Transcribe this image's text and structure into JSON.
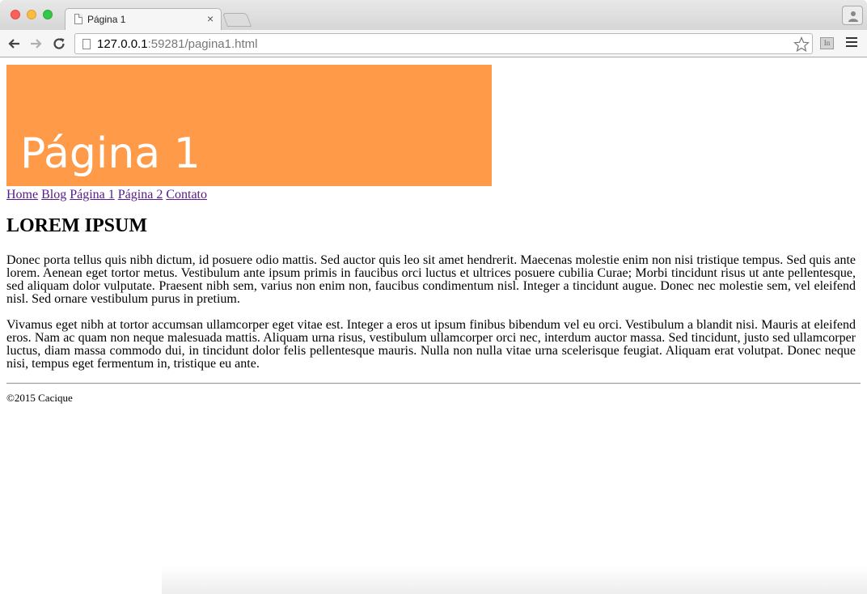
{
  "browser": {
    "tab_title": "Página 1",
    "tab_close": "×",
    "url_host": "127.0.0.1",
    "url_rest": ":59281/pagina1.html",
    "ext_label": "In"
  },
  "page": {
    "banner_title": "Página 1",
    "nav": [
      {
        "label": "Home"
      },
      {
        "label": "Blog"
      },
      {
        "label": "Página 1"
      },
      {
        "label": "Página 2"
      },
      {
        "label": "Contato"
      }
    ],
    "heading": "LOREM IPSUM",
    "paragraphs": [
      "Donec porta tellus quis nibh dictum, id posuere odio mattis. Sed auctor quis leo sit amet hendrerit. Maecenas molestie enim non nisi tristique tempus. Sed quis ante lorem. Aenean eget tortor metus. Vestibulum ante ipsum primis in faucibus orci luctus et ultrices posuere cubilia Curae; Morbi tincidunt risus ut ante pellentesque, sed aliquam dolor vulputate. Praesent nibh sem, varius non enim non, faucibus condimentum nisl. Integer a tincidunt augue. Donec nec molestie sem, vel eleifend nisl. Sed ornare vestibulum purus in pretium.",
      "Vivamus eget nibh at tortor accumsan ullamcorper eget vitae est. Integer a eros ut ipsum finibus bibendum vel eu orci. Vestibulum a blandit nisi. Mauris at eleifend eros. Nam ac quam non neque malesuada mattis. Aliquam urna risus, vestibulum ullamcorper orci nec, interdum auctor massa. Sed tincidunt, justo sed ullamcorper luctus, diam massa commodo dui, in tincidunt dolor felis pellentesque mauris. Nulla non nulla vitae urna scelerisque feugiat. Aliquam erat volutpat. Donec neque nisi, tempus eget fermentum in, tristique eu ante."
    ],
    "footer": "©2015 Cacique"
  },
  "colors": {
    "banner": "#ff9a48",
    "link": "#1a0dab",
    "visited_link": "#551a8b"
  }
}
